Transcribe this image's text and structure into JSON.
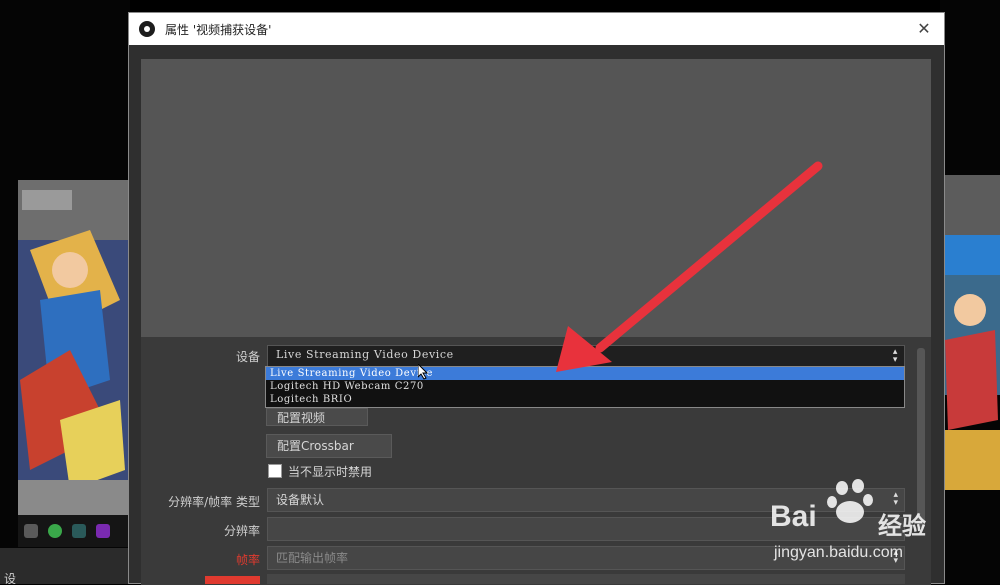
{
  "dialog": {
    "title": "属性 '视频捕获设备'",
    "close_glyph": "✕"
  },
  "form": {
    "device_label": "设备",
    "device_value": "Live Streaming Video Device",
    "device_options": [
      "Live Streaming Video Device",
      "Logitech HD Webcam C270",
      "Logitech BRIO"
    ],
    "configure_video_label": "配置视频",
    "configure_crossbar_label": "配置Crossbar",
    "deactivate_label": "当不显示时禁用",
    "resolution_type_label": "分辨率/帧率 类型",
    "resolution_type_value": "设备默认",
    "resolution_label": "分辨率",
    "resolution_value": "",
    "fps_label": "帧率",
    "fps_value": "匹配输出帧率"
  },
  "watermark": {
    "brand": "Bai",
    "brand_suffix": "经验",
    "url": "jingyan.baidu.com"
  },
  "taskbar": {
    "partial_label": "设"
  },
  "colors": {
    "accent_selection": "#3c7bd9",
    "arrow": "#e8323c",
    "fps_label": "#e03a2f"
  }
}
